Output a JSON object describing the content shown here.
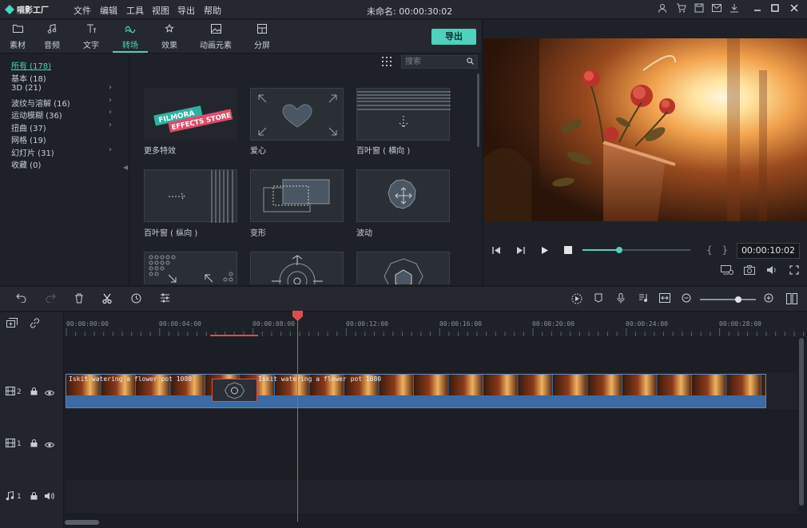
{
  "app": {
    "name": "喵影工厂",
    "sub": "filmora",
    "project_title": "未命名: 00:00:30:02",
    "menu": [
      "文件",
      "编辑",
      "工具",
      "视图",
      "导出",
      "帮助"
    ]
  },
  "tabs": [
    {
      "icon": "folder-icon",
      "label": "素材"
    },
    {
      "icon": "music-note-icon",
      "label": "音频"
    },
    {
      "icon": "text-icon",
      "label": "文字"
    },
    {
      "icon": "transition-icon",
      "label": "转场"
    },
    {
      "icon": "effects-icon",
      "label": "效果"
    },
    {
      "icon": "image-icon",
      "label": "动画元素"
    },
    {
      "icon": "split-screen-icon",
      "label": "分屏"
    }
  ],
  "active_tab": "转场",
  "export_label": "导出",
  "search": {
    "placeholder": "搜索"
  },
  "categories": [
    {
      "label": "所有 (178)",
      "arrow": false,
      "active": true
    },
    {
      "label": "基本 (18)",
      "arrow": false
    },
    {
      "label": "3D (21)",
      "arrow": true
    },
    {
      "label": "波纹与溶解 (16)",
      "arrow": true
    },
    {
      "label": "运动模糊 (36)",
      "arrow": true
    },
    {
      "label": "扭曲 (37)",
      "arrow": true
    },
    {
      "label": "网格 (19)",
      "arrow": false
    },
    {
      "label": "幻灯片 (31)",
      "arrow": true
    },
    {
      "label": "收藏 (0)",
      "arrow": false
    }
  ],
  "thumbnails": [
    {
      "label": "更多特效",
      "kind": "store",
      "banner1": "FILMORA",
      "banner2": "EFFECTS STORE"
    },
    {
      "label": "爱心",
      "kind": "heart"
    },
    {
      "label": "百叶窗 ( 横向 )",
      "kind": "blinds-h"
    },
    {
      "label": "百叶窗 ( 纵向 )",
      "kind": "blinds-v"
    },
    {
      "label": "变形",
      "kind": "morph"
    },
    {
      "label": "波动",
      "kind": "wave"
    },
    {
      "label": "",
      "kind": "dots"
    },
    {
      "label": "",
      "kind": "radial"
    },
    {
      "label": "",
      "kind": "hex"
    }
  ],
  "player": {
    "timecode": "00:00:10:02",
    "progress": 0.34,
    "brackets": "{ }"
  },
  "timeline": {
    "ruler": [
      "00:00:00:00",
      "00:00:04:00",
      "00:00:08:00",
      "00:00:12:00",
      "00:00:16:00",
      "00:00:20:00",
      "00:00:24:00",
      "00:00:28:00"
    ],
    "zoom": 0.68,
    "tracks": [
      {
        "icon": "video-track-icon",
        "num": "2"
      },
      {
        "icon": "video-track-icon",
        "num": "1"
      },
      {
        "icon": "audio-track-icon",
        "num": "1"
      }
    ],
    "clip_name_1": "Iskit watering a flower pot 1080",
    "clip_name_2": "Iskit watering a flower pot 1080"
  },
  "colors": {
    "accent": "#4fd1bd",
    "playhead": "#e04c4c",
    "clip": "#3b6aa5"
  }
}
